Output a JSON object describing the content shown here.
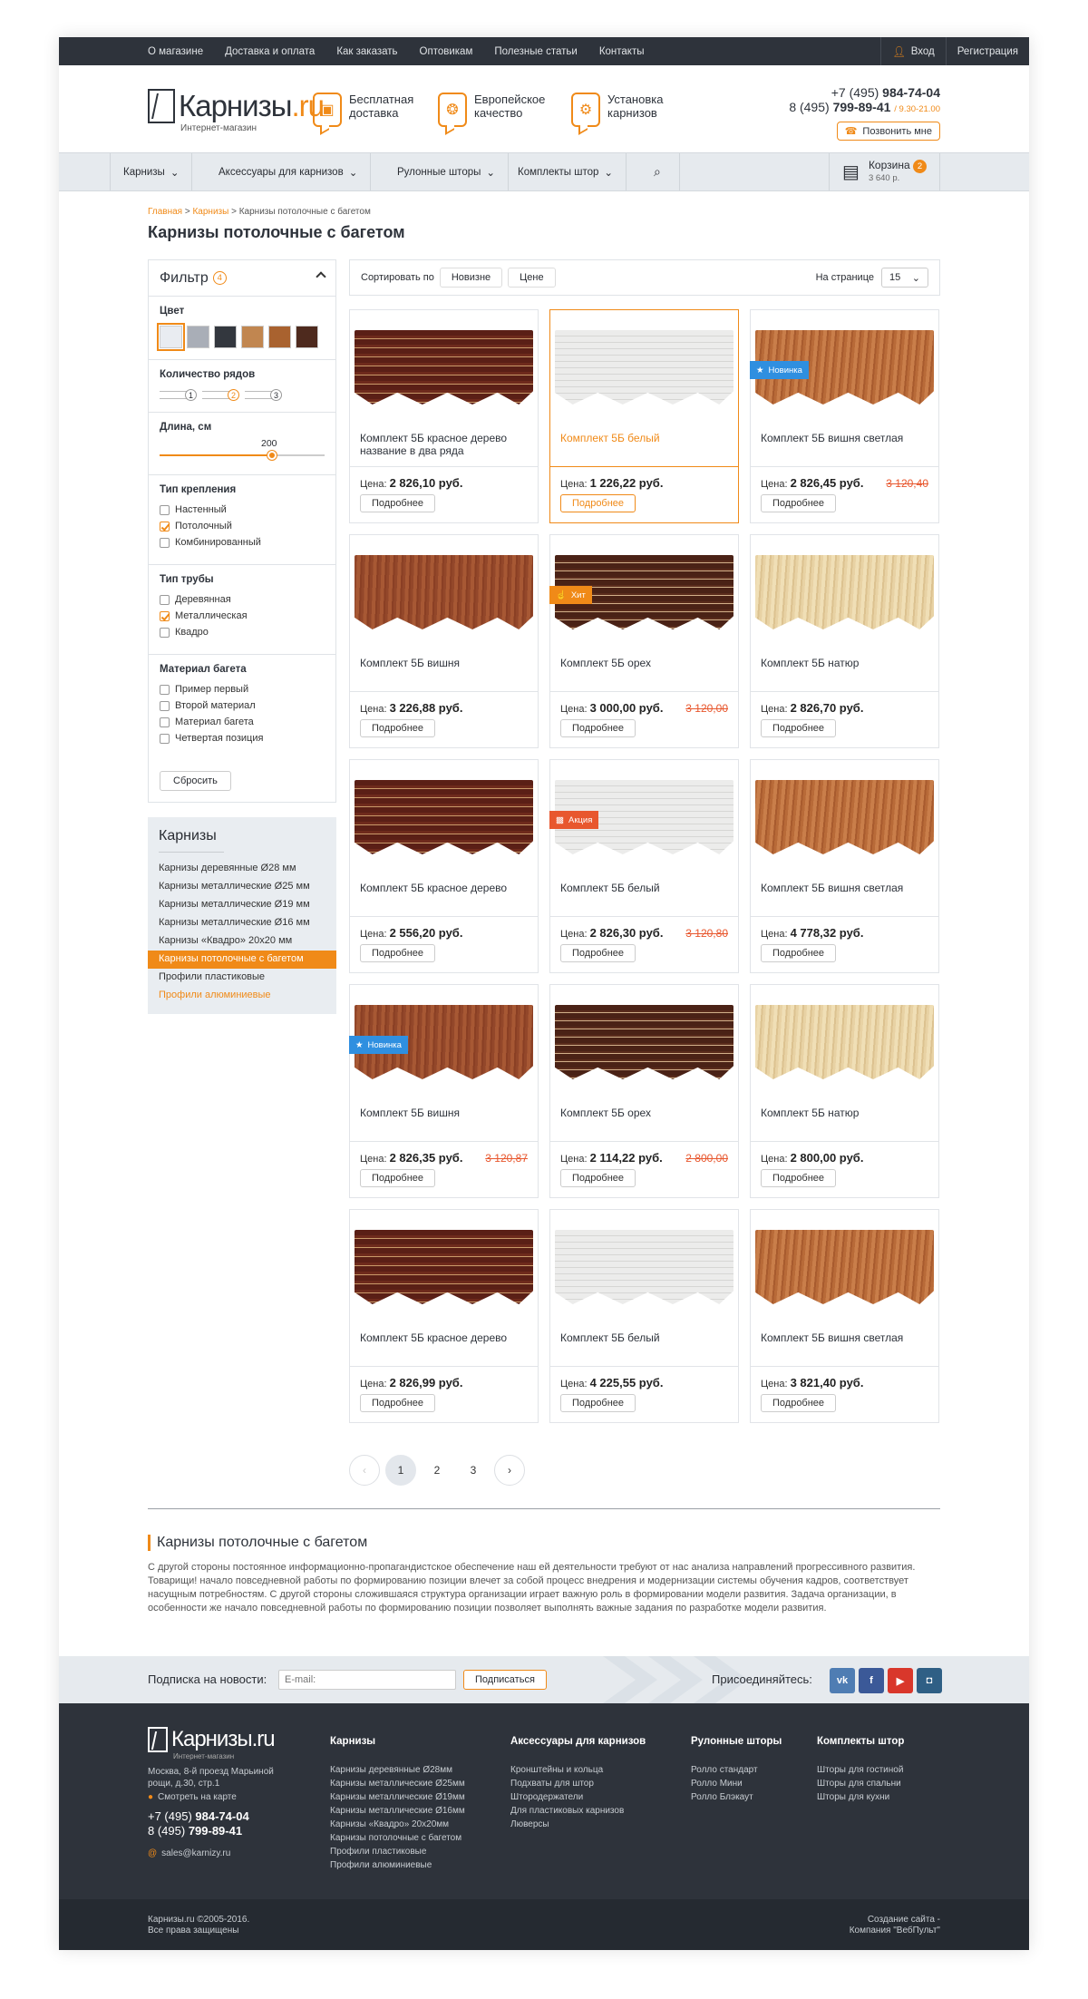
{
  "topnav": [
    "О магазине",
    "Доставка и оплата",
    "Как заказать",
    "Оптовикам",
    "Полезные статьи",
    "Контакты"
  ],
  "auth": {
    "login": "Вход",
    "register": "Регистрация"
  },
  "logo": {
    "main": "Карнизы",
    "dot": ".ru",
    "sub": "Интернет-магазин"
  },
  "features": [
    {
      "icon": "truck-icon",
      "line1": "Бесплатная",
      "line2": "доставка"
    },
    {
      "icon": "medal-icon",
      "line1": "Европейское",
      "line2": "качество"
    },
    {
      "icon": "gear-icon",
      "line1": "Установка",
      "line2": "карнизов"
    }
  ],
  "phones": {
    "p1_prefix": "+7 (495) ",
    "p1_bold": "984-74-04",
    "p2_prefix": "8 (495) ",
    "p2_bold": "799-89-41",
    "hours": "/ 9.30-21.00",
    "callback": "Позвонить мне"
  },
  "catnav": [
    "Карнизы",
    "Аксессуары для карнизов",
    "Рулонные шторы",
    "Комплекты штор"
  ],
  "cart": {
    "label": "Корзина",
    "count": "2",
    "sum": "3 640 р."
  },
  "breadcrumbs": [
    "Главная",
    "Карнизы",
    "Карнизы потолочные с багетом"
  ],
  "page_title": "Карнизы потолочные с багетом",
  "filter": {
    "title": "Фильтр",
    "count": "4",
    "color_title": "Цвет",
    "colors": [
      "#e9ecf1",
      "#a9aeb7",
      "#33373e",
      "#c18650",
      "#a9622f",
      "#4e2a1e"
    ],
    "rows_title": "Количество рядов",
    "rows": [
      "1",
      "2",
      "3"
    ],
    "length_title": "Длина, см",
    "length_value": "200",
    "length_fraction": 0.68,
    "mount_title": "Тип крепления",
    "mount": [
      {
        "label": "Настенный",
        "checked": false
      },
      {
        "label": "Потолочный",
        "checked": true
      },
      {
        "label": "Комбинированный",
        "checked": false
      }
    ],
    "tube_title": "Тип трубы",
    "tube": [
      {
        "label": "Деревянная",
        "checked": false
      },
      {
        "label": "Металлическая",
        "checked": true
      },
      {
        "label": "Квадро",
        "checked": false
      }
    ],
    "material_title": "Материал багета",
    "material": [
      {
        "label": "Пример первый",
        "checked": false
      },
      {
        "label": "Второй материал",
        "checked": false
      },
      {
        "label": "Материал багета",
        "checked": false
      },
      {
        "label": "Четвертая позиция",
        "checked": false
      }
    ],
    "reset": "Сбросить"
  },
  "catbox": {
    "title": "Карнизы",
    "items": [
      "Карнизы деревянные Ø28 мм",
      "Карнизы металлические Ø25 мм",
      "Карнизы металлические Ø19 мм",
      "Карнизы металлические Ø16 мм",
      "Карнизы «Квадро» 20x20 мм",
      "Карнизы потолочные с багетом",
      "Профили пластиковые",
      "Профили алюминиевые"
    ]
  },
  "toolbar": {
    "sort_label": "Сортировать по",
    "sort_new": "Новизне",
    "sort_price": "Цене",
    "per_page_label": "На странице",
    "per_page": "15"
  },
  "products": [
    {
      "name": "Комплект 5Б красное дерево название в два ряда",
      "price": "2 826,10 руб.",
      "old": "",
      "label": "",
      "tex": "red"
    },
    {
      "name": "Комплект 5Б белый",
      "price": "1 226,22 руб.",
      "old": "",
      "label": "",
      "tex": "white"
    },
    {
      "name": "Комплект 5Б вишня светлая",
      "price": "2 826,45 руб.",
      "old": "3 120,40",
      "label": "new",
      "tex": "cherry"
    },
    {
      "name": "Комплект 5Б вишня",
      "price": "3 226,88 руб.",
      "old": "",
      "label": "",
      "tex": "cherry2"
    },
    {
      "name": "Комплект 5Б орех",
      "price": "3 000,00 руб.",
      "old": "3 120,00",
      "label": "hit",
      "tex": "walnut"
    },
    {
      "name": "Комплект 5Б натюр",
      "price": "2 826,70 руб.",
      "old": "",
      "label": "",
      "tex": "natur"
    },
    {
      "name": "Комплект 5Б красное дерево",
      "price": "2 556,20 руб.",
      "old": "",
      "label": "",
      "tex": "red"
    },
    {
      "name": "Комплект 5Б белый",
      "price": "2 826,30 руб.",
      "old": "3 120,80",
      "label": "sale",
      "tex": "white"
    },
    {
      "name": "Комплект 5Б вишня светлая",
      "price": "4 778,32 руб.",
      "old": "",
      "label": "",
      "tex": "cherry"
    },
    {
      "name": "Комплект 5Б вишня",
      "price": "2 826,35 руб.",
      "old": "3 120,87",
      "label": "new",
      "tex": "cherry2"
    },
    {
      "name": "Комплект 5Б орех",
      "price": "2 114,22 руб.",
      "old": "2 800,00",
      "label": "",
      "tex": "walnut"
    },
    {
      "name": "Комплект 5Б натюр",
      "price": "2 800,00 руб.",
      "old": "",
      "label": "",
      "tex": "natur"
    },
    {
      "name": "Комплект 5Б красное дерево",
      "price": "2 826,99 руб.",
      "old": "",
      "label": "",
      "tex": "red"
    },
    {
      "name": "Комплект 5Б белый",
      "price": "4 225,55 руб.",
      "old": "",
      "label": "",
      "tex": "white"
    },
    {
      "name": "Комплект 5Б вишня светлая",
      "price": "3 821,40 руб.",
      "old": "",
      "label": "",
      "tex": "cherry"
    }
  ],
  "product_common": {
    "price_label": "Цена:",
    "more": "Подробнее"
  },
  "labels": {
    "new": "Новинка",
    "hit": "Хит",
    "sale": "Акция"
  },
  "pager": {
    "prev": "‹",
    "pages": [
      "1",
      "2",
      "3"
    ],
    "next": "›",
    "current": "1"
  },
  "seo": {
    "title": "Карнизы потолочные с багетом",
    "text": "С другой стороны постоянное информационно-пропагандистское обеспечение наш ей деятельности требуют от нас анализа направлений прогрессивного развития. Товарищи! начало повседневной работы по формированию позиции влечет за собой процесс внедрения и модернизации системы обучения кадров, соответствует насущным потребностям. С другой стороны сложившаяся структура организации играет важную роль в формировании модели развития. Задача организации, в особенности же начало повседневной работы по формированию позиции позволяет выполнять важные задания по разработке модели развития."
  },
  "subscribe": {
    "label": "Подписка на новости:",
    "placeholder": "E-mail:",
    "button": "Подписаться",
    "join": "Присоединяйтесь:"
  },
  "social": [
    {
      "icon": "vk-icon",
      "text": "vk",
      "color": "#4f7db3"
    },
    {
      "icon": "facebook-icon",
      "text": "f",
      "color": "#3b5998"
    },
    {
      "icon": "youtube-icon",
      "text": "▶",
      "color": "#d9372b"
    },
    {
      "icon": "instagram-icon",
      "text": "◘",
      "color": "#2f5f85"
    }
  ],
  "footer": {
    "logo_main": "Карнизы",
    "logo_dot": ".ru",
    "logo_sub": "Интернет-магазин",
    "address": "Москва, 8-й проезд Марьиной рощи, д.30, стр.1",
    "map": "Смотреть на карте",
    "p1_prefix": "+7 (495) ",
    "p1_bold": "984-74-04",
    "p2_prefix": "8 (495) ",
    "p2_bold": "799-89-41",
    "email": "sales@karnizy.ru",
    "cols": [
      {
        "title": "Карнизы",
        "items": [
          "Карнизы деревянные Ø28мм",
          "Карнизы металлические Ø25мм",
          "Карнизы металлические Ø19мм",
          "Карнизы металлические Ø16мм",
          "Карнизы «Квадро» 20x20мм",
          "Карнизы потолочные с багетом",
          "Профили пластиковые",
          "Профили алюминиевые"
        ]
      },
      {
        "title": "Аксессуары для карнизов",
        "items": [
          "Кронштейны и кольца",
          "Подхваты для штор",
          "Штородержатели",
          "Для пластиковых карнизов",
          "Люверсы"
        ]
      },
      {
        "title": "Рулонные шторы",
        "items": [
          "Ролло стандарт",
          "Ролло Мини",
          "Ролло Блэкаут"
        ]
      },
      {
        "title": "Комплекты штор",
        "items": [
          "Шторы для гостиной",
          "Шторы для спальни",
          "Шторы для кухни"
        ]
      }
    ],
    "copy1": "Карнизы.ru ©2005-2016.",
    "copy2": "Все права защищены",
    "dev1": "Создание сайта -",
    "dev2": "Компания \"ВебПульт\""
  },
  "colors": {
    "accent": "#f08a18",
    "dark": "#2e333b",
    "sale": "#e8572e",
    "new": "#2f8fe0"
  }
}
